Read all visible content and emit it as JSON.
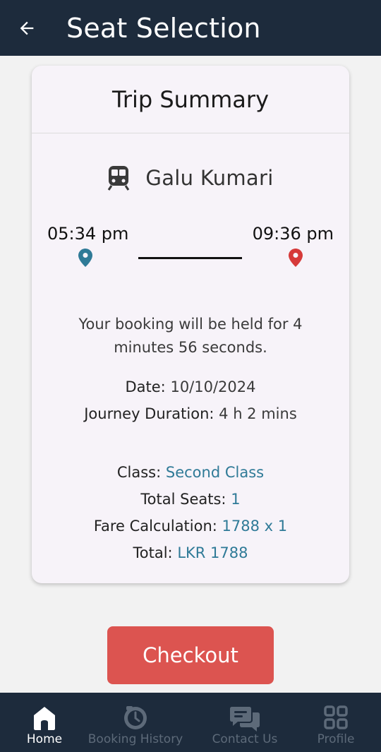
{
  "appbar": {
    "title": "Seat Selection",
    "back_icon": "arrow-left-icon"
  },
  "card": {
    "title": "Trip Summary",
    "train_icon": "train-icon",
    "train_name": "Galu Kumari",
    "departure_time": "05:34 pm",
    "arrival_time": "09:36 pm",
    "departure_pin_color": "#2f7a97",
    "arrival_pin_color": "#d63a3a",
    "hold_message": "Your booking will be held for 4 minutes 56 seconds.",
    "date_label": "Date:",
    "date_value": "10/10/2024",
    "duration_label": "Journey Duration:",
    "duration_value": "4 h 2 mins",
    "class_label": "Class:",
    "class_value": "Second Class",
    "seats_label": "Total Seats:",
    "seats_value": "1",
    "fare_label": "Fare Calculation:",
    "fare_value": "1788 x 1",
    "total_label": "Total:",
    "total_value": "LKR 1788",
    "accent_color": "#2f7a97"
  },
  "checkout": {
    "label": "Checkout",
    "color": "#dc5450"
  },
  "bottom_nav": {
    "items": [
      {
        "label": "Home",
        "icon": "home-icon",
        "active": true
      },
      {
        "label": "Booking History",
        "icon": "clock-history-icon",
        "active": false
      },
      {
        "label": "Contact Us",
        "icon": "chat-bubbles-icon",
        "active": false
      },
      {
        "label": "Profile",
        "icon": "grid-icon",
        "active": false
      }
    ]
  }
}
